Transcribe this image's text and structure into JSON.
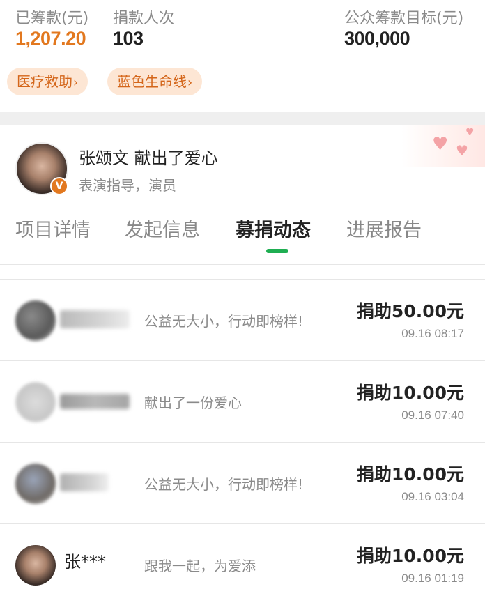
{
  "stats": {
    "raised_label": "已筹款(元)",
    "raised_value": "1,207.20",
    "donors_label": "捐款人次",
    "donors_value": "103",
    "goal_label": "公众筹款目标(元)",
    "goal_value": "300,000"
  },
  "tags": [
    {
      "label": "医疗救助",
      "chevron": "›"
    },
    {
      "label": "蓝色生命线",
      "chevron": "›"
    }
  ],
  "celebrity": {
    "name_action": "张颂文 献出了爱心",
    "title": "表演指导，演员",
    "badge": "V"
  },
  "tabs": [
    {
      "label": "项目详情"
    },
    {
      "label": "发起信息"
    },
    {
      "label": "募捐动态"
    },
    {
      "label": "进展报告"
    }
  ],
  "donations": [
    {
      "name": "",
      "message": "公益无大小，行动即榜样!",
      "amount": "捐助50.00元",
      "time": "09.16 08:17"
    },
    {
      "name": "",
      "message": "献出了一份爱心",
      "amount": "捐助10.00元",
      "time": "09.16 07:40"
    },
    {
      "name": "",
      "message": "公益无大小，行动即榜样!",
      "amount": "捐助10.00元",
      "time": "09.16 03:04"
    },
    {
      "name": "张***",
      "message": "跟我一起，为爱添",
      "amount": "捐助10.00元",
      "time": "09.16 01:19"
    }
  ],
  "colors": {
    "accent_orange": "#e2781f",
    "tag_bg": "#fde6d4",
    "tab_indicator_green": "#1fae52"
  }
}
